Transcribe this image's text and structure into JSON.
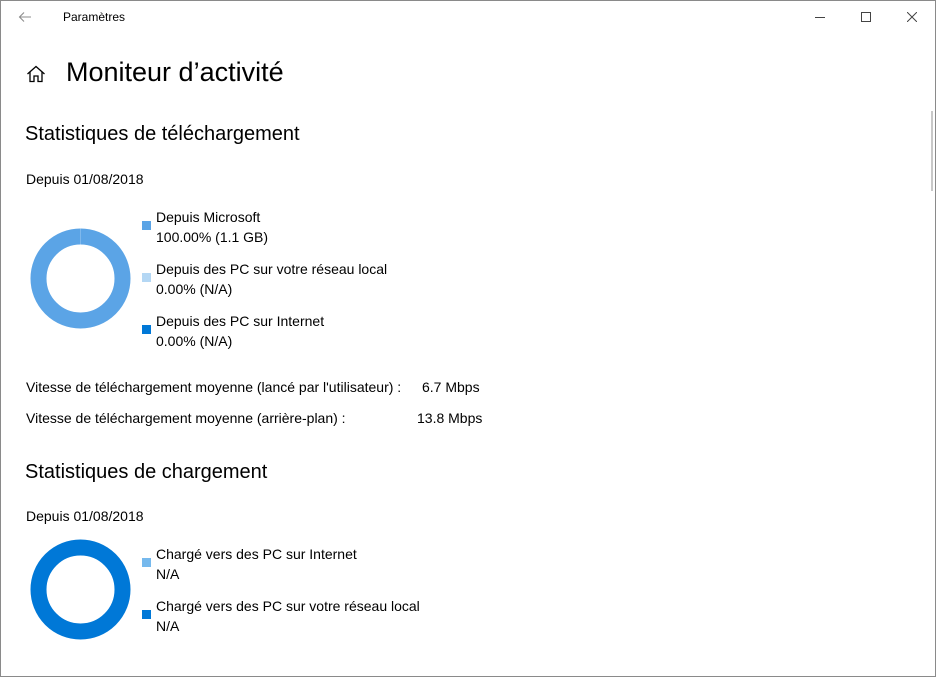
{
  "window": {
    "title": "Paramètres",
    "back_icon": "back-arrow-icon",
    "controls": [
      "minimize-icon",
      "maximize-icon",
      "close-icon"
    ]
  },
  "page": {
    "title": "Moniteur d’activité",
    "home_icon": "home-icon"
  },
  "download": {
    "title": "Statistiques de téléchargement",
    "since": "Depuis 01/08/2018",
    "legend": [
      {
        "label": "Depuis Microsoft",
        "value": "100.00%  (1.1 GB)",
        "color": "#5ba4e6",
        "percent": 100
      },
      {
        "label": "Depuis des PC sur votre réseau local",
        "value": "0.00%  (N/A)",
        "color": "#b4d7f4",
        "percent": 0
      },
      {
        "label": "Depuis des PC sur Internet",
        "value": "0.00%  (N/A)",
        "color": "#0078d7",
        "percent": 0
      }
    ],
    "speed_user_label": "Vitesse de téléchargement moyenne (lancé par l'utilisateur) :",
    "speed_user_value": "6.7 Mbps",
    "speed_bg_label": "Vitesse de téléchargement moyenne (arrière-plan) :",
    "speed_bg_value": "13.8 Mbps"
  },
  "upload": {
    "title": "Statistiques de chargement",
    "since": "Depuis 01/08/2018",
    "legend": [
      {
        "label": "Chargé vers des PC sur Internet",
        "value": "N/A",
        "color": "#76b9ed"
      },
      {
        "label": "Chargé vers des PC sur votre réseau local",
        "value": "N/A",
        "color": "#0078d7"
      }
    ],
    "ring_color": "#0078d7"
  }
}
